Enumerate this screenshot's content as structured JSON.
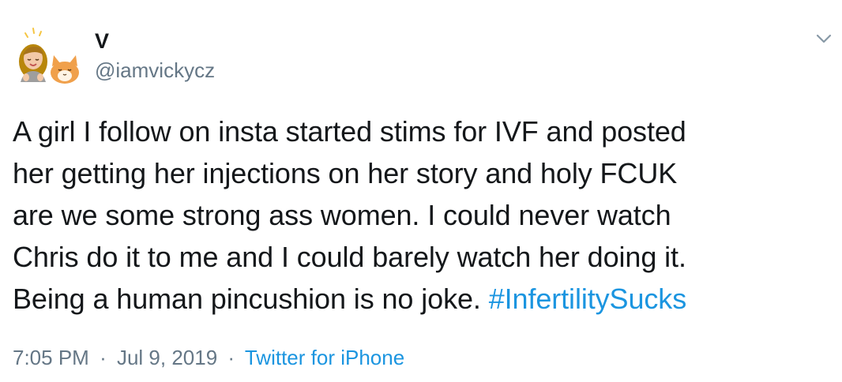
{
  "author": {
    "display_name": "V",
    "handle": "@iamvickycz",
    "avatar_icon": "memoji-girl-with-cat-avatar"
  },
  "menu": {
    "icon": "chevron-down-icon"
  },
  "tweet": {
    "lines": [
      "A girl I follow on insta started stims for IVF and posted",
      "her getting her injections on her story and holy FCUK",
      "are we some strong ass women. I could never watch",
      "Chris do it to me and I could barely watch her doing it.",
      "Being a human pincushion is no joke. "
    ],
    "hashtag": "#InfertilitySucks"
  },
  "meta": {
    "time": "7:05 PM",
    "separator": "·",
    "date": "Jul 9, 2019",
    "source": "Twitter for iPhone"
  },
  "colors": {
    "text": "#14171a",
    "secondary": "#657786",
    "link": "#1b95e0"
  }
}
